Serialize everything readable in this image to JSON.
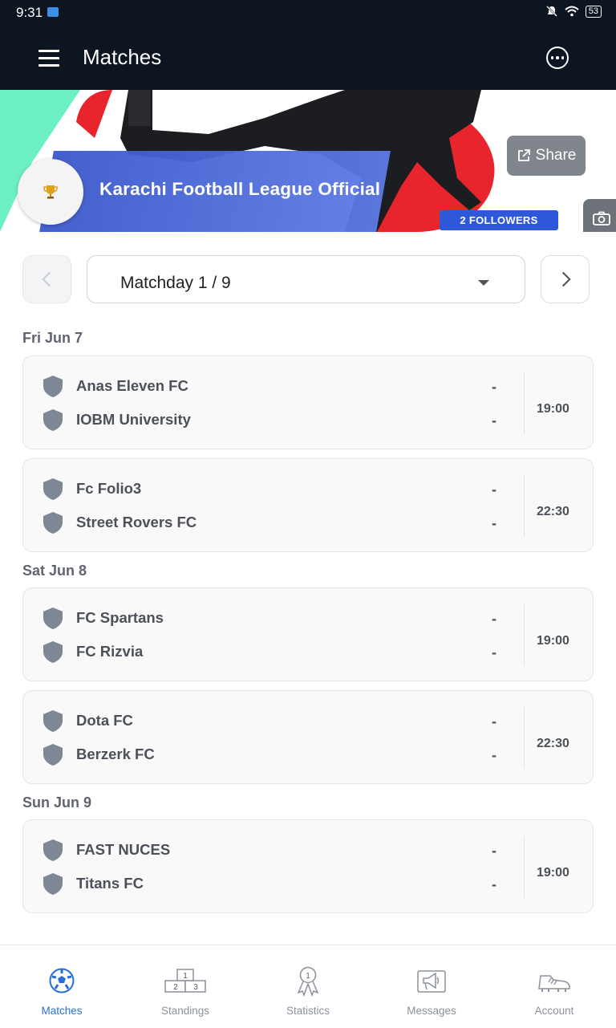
{
  "status_bar": {
    "time": "9:31",
    "battery": "53"
  },
  "app_bar": {
    "title": "Matches",
    "menu_icon": "hamburger-menu-icon",
    "more_icon": "more-options-icon"
  },
  "league": {
    "name": "Karachi Football League Official",
    "share_label": "Share",
    "followers_label": "2 FOLLOWERS",
    "logo_icon": "trophy-icon"
  },
  "matchday": {
    "label": "Matchday 1 / 9"
  },
  "days": [
    {
      "date": "Fri Jun 7",
      "matches": [
        {
          "home": "Anas Eleven FC",
          "home_score": "-",
          "away": "IOBM University",
          "away_score": "-",
          "time": "19:00"
        },
        {
          "home": "Fc Folio3",
          "home_score": "-",
          "away": "Street Rovers FC",
          "away_score": "-",
          "time": "22:30"
        }
      ]
    },
    {
      "date": "Sat Jun 8",
      "matches": [
        {
          "home": "FC Spartans",
          "home_score": "-",
          "away": "FC Rizvia",
          "away_score": "-",
          "time": "19:00"
        },
        {
          "home": "Dota FC",
          "home_score": "-",
          "away": "Berzerk FC",
          "away_score": "-",
          "time": "22:30"
        }
      ]
    },
    {
      "date": "Sun Jun 9",
      "matches": [
        {
          "home": "FAST NUCES",
          "home_score": "-",
          "away": "Titans FC",
          "away_score": "-",
          "time": "19:00"
        }
      ]
    }
  ],
  "bottom_nav": [
    {
      "label": "Matches",
      "icon": "soccer-ball-icon",
      "active": true
    },
    {
      "label": "Standings",
      "icon": "podium-icon",
      "active": false
    },
    {
      "label": "Statistics",
      "icon": "medal-icon",
      "active": false
    },
    {
      "label": "Messages",
      "icon": "megaphone-icon",
      "active": false
    },
    {
      "label": "Account",
      "icon": "football-boot-icon",
      "active": false
    }
  ],
  "colors": {
    "app_bar": "#0d1520",
    "accent": "#2a6fd4",
    "followers_badge": "#2f58d8",
    "banner_band": "#4a67d8"
  }
}
